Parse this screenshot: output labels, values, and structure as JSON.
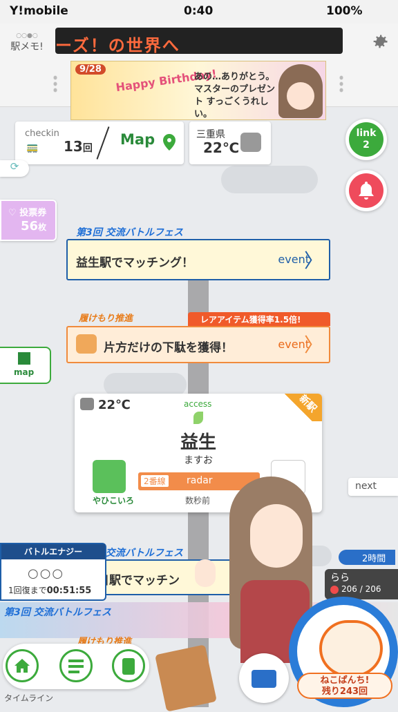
{
  "status_bar": {
    "carrier": "Y!mobile",
    "time": "0:40",
    "battery": "100%"
  },
  "header": {
    "logo_text": "駅メモ!",
    "ticker_text": "ーズ！の世界へ",
    "banner": {
      "date": "9/28",
      "headline": "Happy Birthday!",
      "message": "あの…ありがとう。マスターのプレゼント すっごくうれしい。"
    }
  },
  "checkin": {
    "label": "checkin",
    "count": "13",
    "count_unit": "回",
    "map_label": "Map"
  },
  "weather": {
    "prefecture": "三重県",
    "temperature": "22℃"
  },
  "link_button": {
    "label": "link",
    "count": "2"
  },
  "vote": {
    "label": "投票券",
    "count": "56",
    "unit": "枚"
  },
  "map_side": {
    "label": "map"
  },
  "events": [
    {
      "badge": "第3回 交流バトルフェス",
      "title": "益生駅でマッチング！",
      "label": "event"
    },
    {
      "badge": "履けもり推進",
      "rare_banner": "レアアイテム獲得率1.5倍!",
      "title": "片方だけの下駄を獲得！",
      "label": "event"
    },
    {
      "badge": "第3回 交流バトルフェス",
      "title": "朝日駅でマッチン"
    }
  ],
  "station": {
    "temperature": "22℃",
    "access_label": "access",
    "name": "益生",
    "kana": "ますお",
    "line_no": "2番線",
    "radar": "radar",
    "time_ago": "数秒前",
    "partner": "やひこいろ",
    "new_tag": "新駅"
  },
  "next_label": "next",
  "energy": {
    "title": "バトルエナジー",
    "circles": "○○○",
    "recover_label": "1回復まで",
    "recover_time": "00:51:55"
  },
  "lower_badges": {
    "fest": "第3回 交流バトルフェス",
    "fmori": "履けもり推進"
  },
  "right_panel": {
    "duration": "2時間",
    "name": "らら",
    "hp": "206 / 206",
    "pan_label": "ねこぱんち!",
    "pan_count": "残り243回"
  },
  "nav": {
    "timeline_label": "タイムライン"
  },
  "colors": {
    "green": "#3caa3c",
    "blue": "#1e5ea8",
    "orange": "#f08a3c",
    "red": "#ef4b5c"
  }
}
